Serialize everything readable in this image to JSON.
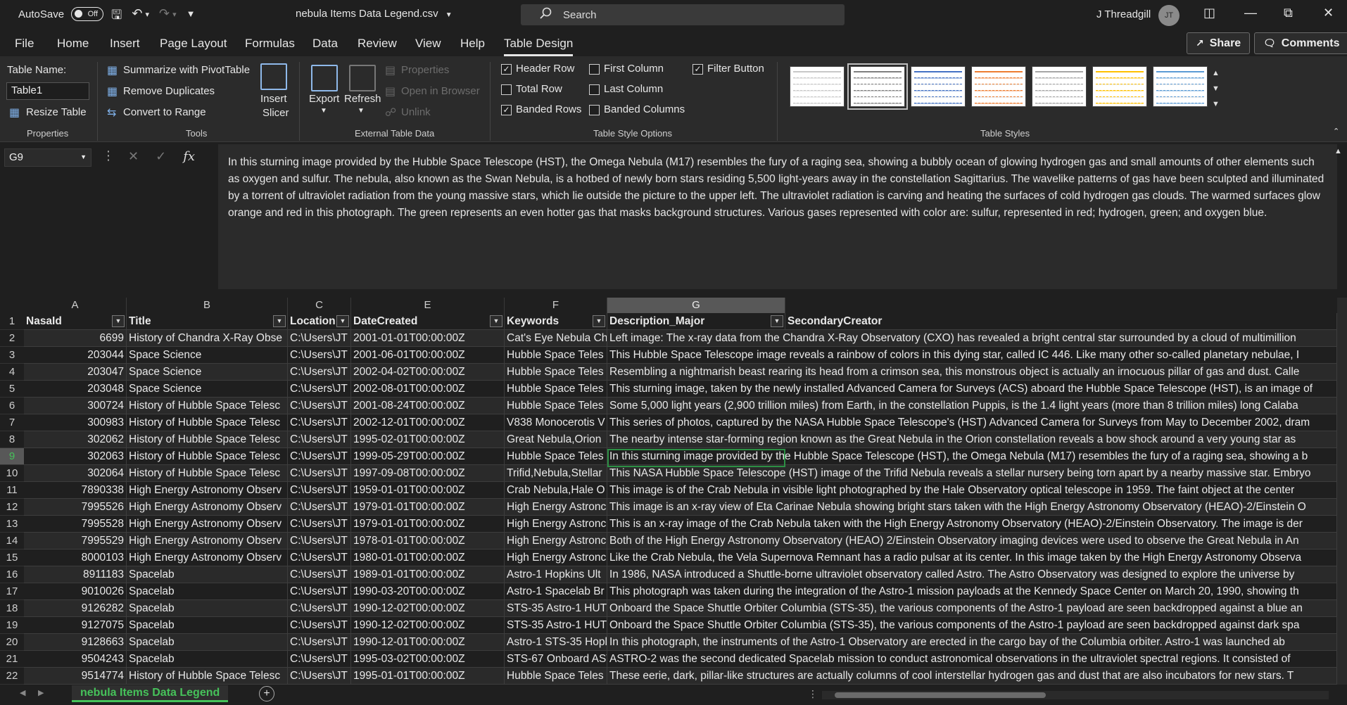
{
  "titlebar": {
    "autosave_label": "AutoSave",
    "autosave_state": "Off",
    "doc_title": "nebula Items Data Legend.csv",
    "search_placeholder": "Search",
    "user_name": "J Threadgill",
    "user_initials": "JT"
  },
  "tabs": [
    "File",
    "Home",
    "Insert",
    "Page Layout",
    "Formulas",
    "Data",
    "Review",
    "View",
    "Help",
    "Table Design"
  ],
  "active_tab": "Table Design",
  "share_label": "Share",
  "comments_label": "Comments",
  "ribbon": {
    "properties": {
      "table_name_label": "Table Name:",
      "table_name_value": "Table1",
      "resize_label": "Resize Table",
      "group_label": "Properties"
    },
    "tools": {
      "pivot_label": "Summarize with PivotTable",
      "remove_dup_label": "Remove Duplicates",
      "convert_label": "Convert to Range",
      "slicer_label_1": "Insert",
      "slicer_label_2": "Slicer",
      "group_label": "Tools"
    },
    "external": {
      "export_label": "Export",
      "refresh_label": "Refresh",
      "properties_label": "Properties",
      "open_browser_label": "Open in Browser",
      "unlink_label": "Unlink",
      "group_label": "External Table Data"
    },
    "style_options": {
      "header_row": "Header Row",
      "total_row": "Total Row",
      "banded_rows": "Banded Rows",
      "first_column": "First Column",
      "last_column": "Last Column",
      "banded_columns": "Banded Columns",
      "filter_button": "Filter Button",
      "header_row_checked": true,
      "total_row_checked": false,
      "banded_rows_checked": true,
      "first_column_checked": false,
      "last_column_checked": false,
      "banded_columns_checked": false,
      "filter_button_checked": true,
      "group_label": "Table Style Options"
    },
    "table_styles": {
      "group_label": "Table Styles",
      "accents": [
        "#c8c8c8",
        "#7f7f7f",
        "#4472c4",
        "#ed7d31",
        "#a5a5a5",
        "#ffc000",
        "#5b9bd5"
      ]
    }
  },
  "formula_bar": {
    "name_box": "G9",
    "fx": "fx",
    "content": "In this sturning image provided by the Hubble Space Telescope (HST), the Omega Nebula (M17) resembles the fury of a raging sea, showing a bubbly ocean of glowing hydrogen gas and small amounts of other elements such as oxygen and sulfur. The nebula, also known as the Swan Nebula, is a hotbed of newly born stars residing 5,500 light-years away in the constellation Sagittarius. The wavelike patterns of gas have been sculpted and illuminated by a torrent of ultraviolet radiation from the young massive stars, which lie outside the picture to the upper left. The ultraviolet radiation is carving and heating the surfaces of cold hydrogen gas clouds. The warmed surfaces glow orange and red in this photograph. The green represents an even hotter gas that masks background structures. Various gases represented with color are: sulfur, represented in red; hydrogen, green; and oxygen blue."
  },
  "columns": [
    "A",
    "B",
    "C",
    "E",
    "F",
    "G"
  ],
  "selected_column": "G",
  "header": [
    "NasaId",
    "Title",
    "Location",
    "DateCreated",
    "Keywords",
    "Description_Major",
    "SecondaryCreator"
  ],
  "rows": [
    [
      "6699",
      "History of Chandra X-Ray Obse",
      "C:\\Users\\JT",
      "2001-01-01T00:00:00Z",
      "Cat's Eye Nebula Ch",
      "Left image: The x-ray data from the Chandra X-Ray Observatory (CXO) has revealed a bright central star surrounded by a cloud of multimillion"
    ],
    [
      "203044",
      "Space Science",
      "C:\\Users\\JT",
      "2001-06-01T00:00:00Z",
      "Hubble Space Teles",
      "This Hubble Space Telescope image reveals a rainbow of colors in this dying star, called IC 446. Like many other so-called planetary nebulae, I"
    ],
    [
      "203047",
      "Space Science",
      "C:\\Users\\JT",
      "2002-04-02T00:00:00Z",
      "Hubble Space Teles",
      "Resembling a nightmarish beast rearing its head from a crimson sea, this monstrous object is actually an irnocuous pillar of gas and dust. Calle"
    ],
    [
      "203048",
      "Space Science",
      "C:\\Users\\JT",
      "2002-08-01T00:00:00Z",
      "Hubble Space Teles",
      "This sturning image, taken by the newly installed Advanced Camera for Surveys (ACS) aboard the Hubble Space Telescope (HST), is an image of"
    ],
    [
      "300724",
      "History of Hubble Space Telesc",
      "C:\\Users\\JT",
      "2001-08-24T00:00:00Z",
      "Hubble Space Teles",
      "Some 5,000 light years (2,900 trillion miles) from Earth, in the constellation Puppis, is the 1.4 light years (more than 8 trillion miles) long Calaba"
    ],
    [
      "300983",
      "History of Hubble Space Telesc",
      "C:\\Users\\JT",
      "2002-12-01T00:00:00Z",
      "V838 Monocerotis V",
      "This series of photos, captured by the NASA Hubble Space Telescope's (HST) Advanced Camera for Surveys from May to December 2002, dram"
    ],
    [
      "302062",
      "History of Hubble Space Telesc",
      "C:\\Users\\JT",
      "1995-02-01T00:00:00Z",
      "Great Nebula,Orion",
      "The nearby intense star-forming region known as the Great Nebula in the Orion constellation reveals a bow shock around a very young star as"
    ],
    [
      "302063",
      "History of Hubble Space Telesc",
      "C:\\Users\\JT",
      "1999-05-29T00:00:00Z",
      "Hubble Space Teles",
      "In this sturning image provided by the Hubble Space Telescope (HST), the Omega Nebula (M17) resembles the fury of a raging sea, showing a b"
    ],
    [
      "302064",
      "History of Hubble Space Telesc",
      "C:\\Users\\JT",
      "1997-09-08T00:00:00Z",
      "Trifid,Nebula,Stellar",
      "This NASA Hubble Space Telescope (HST) image of the Trifid Nebula reveals a stellar nursery being torn apart by a nearby massive star. Embryo"
    ],
    [
      "7890338",
      "High Energy Astronomy Observ",
      "C:\\Users\\JT",
      "1959-01-01T00:00:00Z",
      "Crab Nebula,Hale O",
      "This image is of the Crab Nebula in visible light photographed by the Hale Observatory optical telescope in 1959. The faint object at the center"
    ],
    [
      "7995526",
      "High Energy Astronomy Observ",
      "C:\\Users\\JT",
      "1979-01-01T00:00:00Z",
      "High Energy Astronc",
      "This image is an x-ray view of Eta Carinae Nebula showing bright stars taken with the High Energy Astronomy Observatory (HEAO)-2/Einstein O"
    ],
    [
      "7995528",
      "High Energy Astronomy Observ",
      "C:\\Users\\JT",
      "1979-01-01T00:00:00Z",
      "High Energy Astronc",
      "This is an x-ray image of the Crab Nebula taken with the High Energy Astronomy Observatory (HEAO)-2/Einstein Observatory. The image is der"
    ],
    [
      "7995529",
      "High Energy Astronomy Observ",
      "C:\\Users\\JT",
      "1978-01-01T00:00:00Z",
      "High Energy Astronc",
      "Both of the High Energy Astronomy Observatory (HEAO) 2/Einstein Observatory imaging devices were used to observe the Great Nebula in An"
    ],
    [
      "8000103",
      "High Energy Astronomy Observ",
      "C:\\Users\\JT",
      "1980-01-01T00:00:00Z",
      "High Energy Astronc",
      "Like the Crab Nebula, the Vela Supernova Remnant has a radio pulsar at its center. In this image taken by the High Energy Astronomy Observa"
    ],
    [
      "8911183",
      "Spacelab",
      "C:\\Users\\JT",
      "1989-01-01T00:00:00Z",
      "Astro-1 Hopkins Ult",
      "In 1986, NASA introduced a Shuttle-borne ultraviolet observatory called Astro. The Astro Observatory was designed to explore the universe by"
    ],
    [
      "9010026",
      "Spacelab",
      "C:\\Users\\JT",
      "1990-03-20T00:00:00Z",
      "Astro-1 Spacelab Br",
      "This photograph was taken during the integration of the Astro-1 mission payloads at the Kennedy Space Center on March 20, 1990, showing th"
    ],
    [
      "9126282",
      "Spacelab",
      "C:\\Users\\JT",
      "1990-12-02T00:00:00Z",
      "STS-35 Astro-1 HUT",
      "Onboard the Space Shuttle Orbiter Columbia (STS-35), the various components of the Astro-1 payload are seen backdropped against a blue an"
    ],
    [
      "9127075",
      "Spacelab",
      "C:\\Users\\JT",
      "1990-12-02T00:00:00Z",
      "STS-35 Astro-1 HUT",
      "Onboard the Space Shuttle Orbiter Columbia (STS-35), the various components of the Astro-1 payload are seen backdropped against dark spa"
    ],
    [
      "9128663",
      "Spacelab",
      "C:\\Users\\JT",
      "1990-12-01T00:00:00Z",
      "Astro-1 STS-35 Hopl",
      "In this photograph, the instruments of the Astro-1 Observatory are erected in the cargo bay of the Columbia orbiter. Astro-1 was launched ab"
    ],
    [
      "9504243",
      "Spacelab",
      "C:\\Users\\JT",
      "1995-03-02T00:00:00Z",
      "STS-67 Onboard AST",
      "ASTRO-2 was the second dedicated Spacelab mission to conduct astronomical observations in the ultraviolet spectral regions. It consisted of"
    ],
    [
      "9514774",
      "History of Hubble Space Telesc",
      "C:\\Users\\JT",
      "1995-01-01T00:00:00Z",
      "Hubble Space Teles",
      "These eerie, dark, pillar-like structures are actually columns of cool interstellar hydrogen gas and dust that are also incubators for new stars. T"
    ]
  ],
  "row_numbers": [
    "1",
    "2",
    "3",
    "4",
    "5",
    "6",
    "7",
    "8",
    "9",
    "10",
    "11",
    "12",
    "13",
    "14",
    "15",
    "16",
    "17",
    "18",
    "19",
    "20",
    "21",
    "22"
  ],
  "selected_row": "9",
  "active_cell_text": "In this sturning image provided by",
  "sheet_tab": "nebula Items Data Legend",
  "colors": {
    "accent_green": "#46c25a",
    "grid_bg": "#1f1f1f",
    "band_bg": "#2a2a2a"
  }
}
